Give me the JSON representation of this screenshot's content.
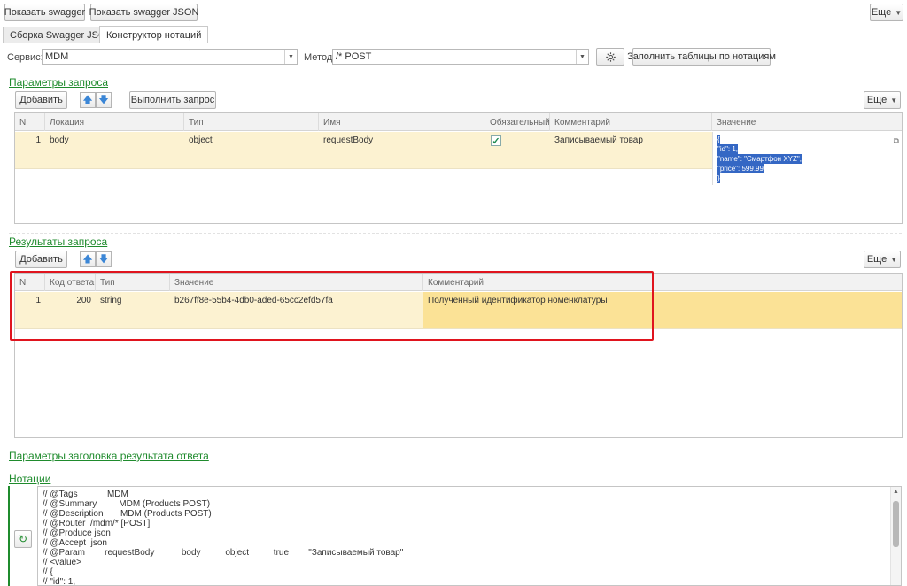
{
  "toolbar": {
    "show_swagger": "Показать swagger",
    "show_swagger_json": "Показать swagger JSON",
    "more": "Еще"
  },
  "tabs": [
    {
      "label": "Сборка Swagger JSON",
      "active": false
    },
    {
      "label": "Конструктор нотаций",
      "active": true
    }
  ],
  "form": {
    "service_label": "Сервис:",
    "service_value": "MDM",
    "method_label": "Метод:",
    "method_value": "/* POST",
    "fill_button": "Заполнить таблицы по нотациям",
    "settings_icon": "gear-icon"
  },
  "request_params": {
    "title": "Параметры запроса",
    "add_button": "Добавить",
    "execute_button": "Выполнить запрос",
    "more": "Еще",
    "columns": [
      "N",
      "Локация",
      "Тип",
      "Имя",
      "Обязательный",
      "Комментарий",
      "Значение"
    ],
    "rows": [
      {
        "n": "1",
        "location": "body",
        "type": "object",
        "name": "requestBody",
        "required": true,
        "comment": "Записываемый товар",
        "value_lines": [
          "{",
          "\"id\": 1,",
          "\"name\": \"Смартфон XYZ\",",
          "\"price\": 599.99",
          "}"
        ]
      }
    ]
  },
  "request_results": {
    "title": "Результаты запроса",
    "add_button": "Добавить",
    "more": "Еще",
    "columns": [
      "N",
      "Код ответа",
      "Тип",
      "Значение",
      "Комментарий"
    ],
    "rows": [
      {
        "n": "1",
        "code": "200",
        "type": "string",
        "value": "b267ff8e-55b4-4db0-aded-65cc2efd57fa",
        "comment": "Полученный идентификатор номенклатуры"
      }
    ]
  },
  "response_headers": {
    "title": "Параметры заголовка результата ответа"
  },
  "notations": {
    "title": "Нотации",
    "lines": [
      "// @Tags            MDM",
      "// @Summary         MDM (Products POST)",
      "// @Description       MDM (Products POST)",
      "// @Router  /mdm/* [POST]",
      "// @Produce json",
      "// @Accept  json",
      "// @Param        requestBody           body          object          true        \"Записываемый товар\"",
      "// <value>",
      "// {",
      "// \"id\": 1,"
    ]
  },
  "colors": {
    "accent_green": "#1f8b2d",
    "row_highlight": "#fcf2d1",
    "selection_red": "#e0141e",
    "json_selection": "#3467c4"
  }
}
